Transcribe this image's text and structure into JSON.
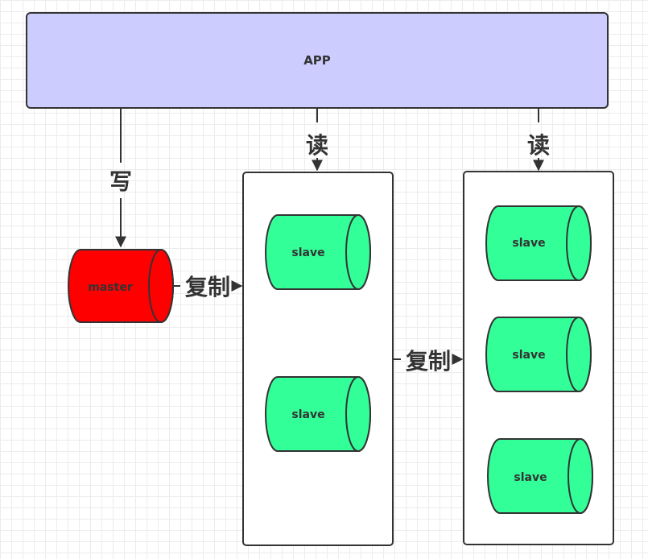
{
  "app": {
    "label": "APP"
  },
  "edges": {
    "write_label": "写",
    "read_label_1": "读",
    "read_label_2": "读",
    "replicate_label_1": "复制",
    "replicate_label_2": "复制"
  },
  "nodes": {
    "master": {
      "label": "master"
    },
    "group1": [
      {
        "label": "slave"
      },
      {
        "label": "slave"
      }
    ],
    "group2": [
      {
        "label": "slave"
      },
      {
        "label": "slave"
      },
      {
        "label": "slave"
      }
    ]
  },
  "colors": {
    "app_fill": "#ccccff",
    "master_fill": "#ff0000",
    "slave_fill": "#33ff99",
    "stroke": "#333333"
  }
}
